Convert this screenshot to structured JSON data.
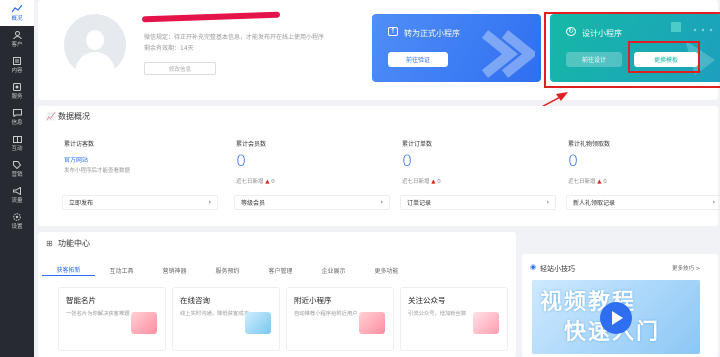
{
  "sidebar": {
    "items": [
      {
        "label": "概况",
        "icon": "chart-icon",
        "active": true
      },
      {
        "label": "客户",
        "icon": "user-icon"
      },
      {
        "label": "内容",
        "icon": "document-icon"
      },
      {
        "label": "服务",
        "icon": "service-icon"
      },
      {
        "label": "信息",
        "icon": "message-icon"
      },
      {
        "label": "互动",
        "icon": "interact-icon"
      },
      {
        "label": "营销",
        "icon": "tag-icon"
      },
      {
        "label": "流量",
        "icon": "megaphone-icon"
      },
      {
        "label": "设置",
        "icon": "gear-icon"
      }
    ]
  },
  "profile": {
    "hint_line1": "微信规定：待正开补充完整基本信息，才能发布开在线上使用小程序",
    "hint_line2": "剩余有效期：14天",
    "button": "修改信息"
  },
  "banners": {
    "formal": {
      "title": "转为正式小程序",
      "button": "前往验证"
    },
    "design": {
      "title": "设计小程序",
      "button_left": "前往设计",
      "button_right": "更换模板"
    }
  },
  "overview": {
    "title": "数据概况",
    "stats": [
      {
        "label": "累计访客数",
        "value": "",
        "link": "官方网站",
        "note": "发布小程序后才能查看数据",
        "footer": "立即发布"
      },
      {
        "label": "累计会员数",
        "value": "0",
        "sub": "近七日新增",
        "sub_val": "0",
        "footer": "等级会员"
      },
      {
        "label": "累计订单数",
        "value": "0",
        "sub": "近七日新增",
        "sub_val": "0",
        "footer": "订单记录"
      },
      {
        "label": "累计礼物领取数",
        "value": "0",
        "sub": "近七日新增",
        "sub_val": "0",
        "footer": "新人礼领取记录"
      }
    ]
  },
  "features": {
    "title": "功能中心",
    "tabs": [
      "获客拓新",
      "互动工具",
      "营销神器",
      "服务预约",
      "客户管理",
      "企业展示",
      "更多功能"
    ],
    "cards": [
      {
        "title": "智能名片",
        "desc": "一张名片为你解决获客难题"
      },
      {
        "title": "在线咨询",
        "desc": "线上实时沟通，降低获客成本"
      },
      {
        "title": "附近小程序",
        "desc": "自动推荐小程序给附近用户"
      },
      {
        "title": "关注公众号",
        "desc": "引流公众号，增加粉丝数"
      }
    ]
  },
  "tips": {
    "title": "轻站小技巧",
    "more": "更多技巧 >",
    "video_line1": "视频教程",
    "video_line2": "快速入门"
  },
  "colors": {
    "accent": "#2a6df4",
    "sidebar": "#272a30",
    "annotation": "#e02020"
  }
}
